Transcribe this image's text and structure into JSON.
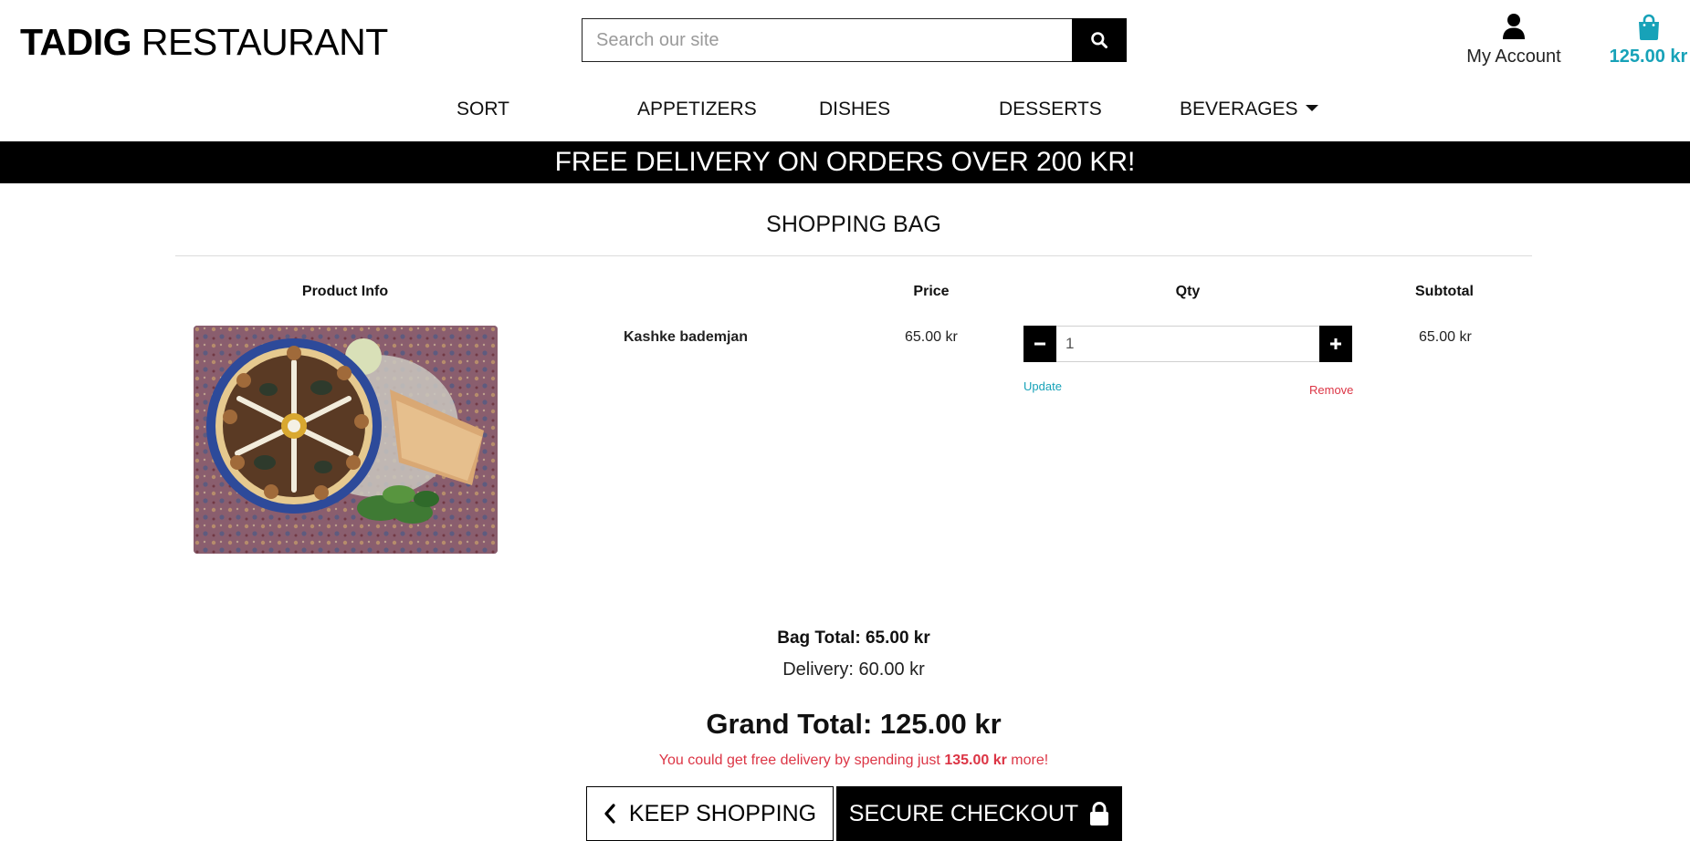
{
  "header": {
    "logo_bold": "TADIG",
    "logo_light": "RESTAURANT",
    "search": {
      "placeholder": "Search our site",
      "value": ""
    },
    "account_label": "My Account",
    "bag_total": "125.00 kr"
  },
  "nav": {
    "items": [
      "SORT",
      "APPETIZERS",
      "DISHES",
      "DESSERTS",
      "BEVERAGES"
    ]
  },
  "banner": {
    "text": "FREE DELIVERY ON ORDERS OVER 200 KR!"
  },
  "bag": {
    "title": "SHOPPING BAG",
    "columns": [
      "Product Info",
      "Price",
      "Qty",
      "Subtotal"
    ],
    "items": [
      {
        "name": "Kashke bademjan",
        "price": "65.00 kr",
        "qty": "1",
        "subtotal": "65.00 kr",
        "update_label": "Update",
        "remove_label": "Remove"
      }
    ]
  },
  "totals": {
    "bag_total": "Bag Total: 65.00 kr",
    "delivery": "Delivery: 60.00 kr",
    "grand_total": "Grand Total: 125.00 kr",
    "free_delivery_prefix": "You could get free delivery by spending just",
    "free_delivery_amount": "135.00 kr",
    "free_delivery_suffix": "more!"
  },
  "actions": {
    "keep_shopping": "KEEP SHOPPING",
    "secure_checkout": "SECURE CHECKOUT"
  },
  "colors": {
    "accent": "#17a2b8",
    "danger": "#dc3545",
    "dark": "#000000"
  },
  "icons": {
    "search": "search-icon",
    "account": "user-icon",
    "bag": "shopping-bag-icon",
    "minus": "minus-icon",
    "plus": "plus-icon",
    "back": "chevron-left-icon",
    "lock": "lock-icon"
  }
}
